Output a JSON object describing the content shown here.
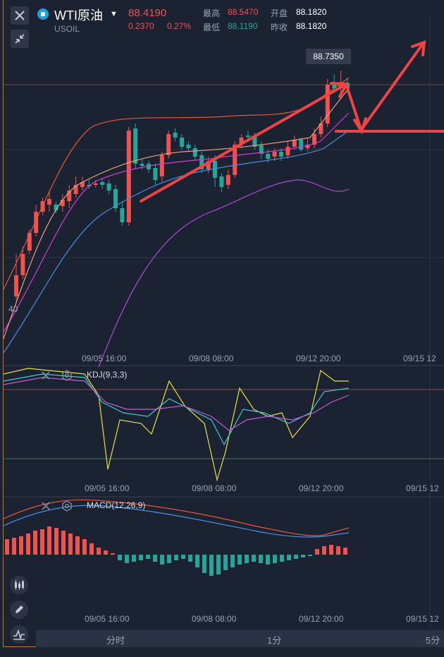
{
  "header": {
    "symbol_name": "WTI原油",
    "symbol_code": "USOIL",
    "price": "88.4190",
    "change": "0.2370",
    "change_pct": "0.27%",
    "high_label": "最高",
    "high_value": "88.5470",
    "open_label": "开盘",
    "open_value": "88.1820",
    "low_label": "最低",
    "low_value": "88.1190",
    "prev_close_label": "昨收",
    "prev_close_value": "88.1820"
  },
  "main_chart": {
    "price_tag": "88.7350",
    "axis_left_label": "40",
    "time_labels": [
      "09/05 16:00",
      "09/08 08:00",
      "09/12 20:00",
      "09/15 12"
    ]
  },
  "kdj": {
    "label": "KDJ(9,3,3)",
    "time_labels": [
      "09/05 16:00",
      "09/08 08:00",
      "09/12 20:00",
      "09/15 12"
    ]
  },
  "macd": {
    "label": "MACD(12,26,9)",
    "time_labels": [
      "09/05 16:00",
      "09/08 08:00",
      "09/12 20:00",
      "09/15 12"
    ]
  },
  "timeframes": [
    "分时",
    "1分",
    "5分"
  ],
  "colors": {
    "up": "#ef5350",
    "down": "#26a69a",
    "accent": "#1fa0d8",
    "background": "#1b2232"
  },
  "icons": [
    "close-icon",
    "collapse-icon",
    "candlestick-icon",
    "pencil-icon",
    "indicator-icon"
  ]
}
